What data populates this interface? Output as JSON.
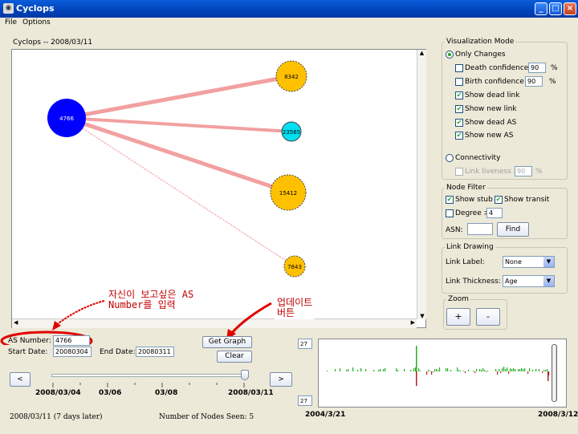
{
  "window": {
    "title": "Cyclops",
    "app_icon": "cyclops-icon"
  },
  "menu": {
    "file": "File",
    "options": "Options"
  },
  "graph": {
    "title": "Cyclops -- 2008/03/11",
    "nodes": [
      {
        "id": "4766",
        "color": "#0000FF"
      },
      {
        "id": "8342",
        "color": "#FFC000"
      },
      {
        "id": "23565",
        "color": "#00E0F0"
      },
      {
        "id": "15412",
        "color": "#FFC000"
      },
      {
        "id": "7843",
        "color": "#FFC000"
      }
    ]
  },
  "form": {
    "as_number_label": "AS Number:",
    "as_number_value": "4766",
    "start_date_label": "Start Date:",
    "start_date_value": "20080304",
    "end_date_label": "End Date:",
    "end_date_value": "20080311",
    "get_graph": "Get Graph",
    "clear": "Clear"
  },
  "annotations": {
    "note1_line1": "자신이 보고싶은 AS",
    "note1_line2": "Number를 입력",
    "note2_line1": "업데이트",
    "note2_line2": "버튼"
  },
  "timeline": {
    "prev": "<",
    "next": ">",
    "ticks": [
      "2008/03/04",
      "03/06",
      "03/08",
      "2008/03/11"
    ],
    "slider_value": 1.0
  },
  "status": {
    "left": "2008/03/11 (7 days later)",
    "nodes_seen": "Number of Nodes Seen: 5"
  },
  "histogram": {
    "top_value": "27",
    "bottom_value": "27",
    "start_date": "2004/3/21",
    "end_date": "2008/3/12"
  },
  "viz_mode": {
    "title": "Visualization Mode",
    "only_changes": "Only Changes",
    "death_conf_label": "Death confidence >",
    "death_conf_value": "90",
    "birth_conf_label": "Birth confidence >",
    "birth_conf_value": "90",
    "percent": "%",
    "show_dead_link": "Show dead link",
    "show_new_link": "Show new link",
    "show_dead_as": "Show dead AS",
    "show_new_as": "Show new AS",
    "connectivity": "Connectivity",
    "link_liveness_label": "Link liveness >",
    "link_liveness_value": "90"
  },
  "node_filter": {
    "title": "Node Filter",
    "show_stub": "Show stub",
    "show_transit": "Show transit",
    "degree_label": "Degree >",
    "degree_value": "4",
    "asn_label": "ASN:",
    "find": "Find"
  },
  "link_drawing": {
    "title": "Link Drawing",
    "label_label": "Link Label:",
    "label_value": "None",
    "thickness_label": "Link Thickness:",
    "thickness_value": "Age"
  },
  "zoom": {
    "title": "Zoom",
    "plus": "+",
    "minus": "-"
  }
}
